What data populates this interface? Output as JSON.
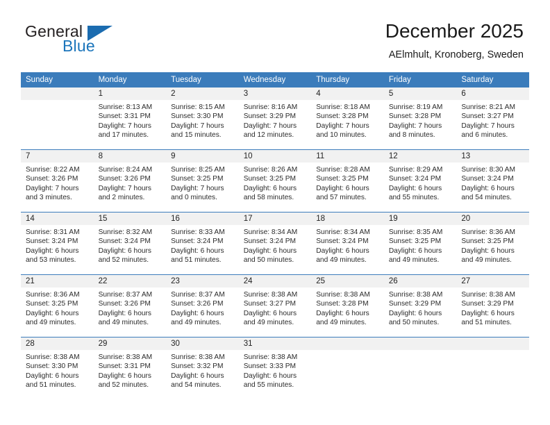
{
  "brand": {
    "name_part1": "General",
    "name_part2": "Blue",
    "logo_icon": "triangle-logo-icon"
  },
  "header": {
    "title": "December 2025",
    "subtitle": "AElmhult, Kronoberg, Sweden"
  },
  "calendar": {
    "weekday_headers": [
      "Sunday",
      "Monday",
      "Tuesday",
      "Wednesday",
      "Thursday",
      "Friday",
      "Saturday"
    ],
    "accent_color": "#3b7cbb",
    "daynum_band_color": "#f1f1f1",
    "weeks": [
      [
        {
          "day": "",
          "sunrise": "",
          "sunset": "",
          "daylight_line1": "",
          "daylight_line2": ""
        },
        {
          "day": "1",
          "sunrise": "Sunrise: 8:13 AM",
          "sunset": "Sunset: 3:31 PM",
          "daylight_line1": "Daylight: 7 hours",
          "daylight_line2": "and 17 minutes."
        },
        {
          "day": "2",
          "sunrise": "Sunrise: 8:15 AM",
          "sunset": "Sunset: 3:30 PM",
          "daylight_line1": "Daylight: 7 hours",
          "daylight_line2": "and 15 minutes."
        },
        {
          "day": "3",
          "sunrise": "Sunrise: 8:16 AM",
          "sunset": "Sunset: 3:29 PM",
          "daylight_line1": "Daylight: 7 hours",
          "daylight_line2": "and 12 minutes."
        },
        {
          "day": "4",
          "sunrise": "Sunrise: 8:18 AM",
          "sunset": "Sunset: 3:28 PM",
          "daylight_line1": "Daylight: 7 hours",
          "daylight_line2": "and 10 minutes."
        },
        {
          "day": "5",
          "sunrise": "Sunrise: 8:19 AM",
          "sunset": "Sunset: 3:28 PM",
          "daylight_line1": "Daylight: 7 hours",
          "daylight_line2": "and 8 minutes."
        },
        {
          "day": "6",
          "sunrise": "Sunrise: 8:21 AM",
          "sunset": "Sunset: 3:27 PM",
          "daylight_line1": "Daylight: 7 hours",
          "daylight_line2": "and 6 minutes."
        }
      ],
      [
        {
          "day": "7",
          "sunrise": "Sunrise: 8:22 AM",
          "sunset": "Sunset: 3:26 PM",
          "daylight_line1": "Daylight: 7 hours",
          "daylight_line2": "and 3 minutes."
        },
        {
          "day": "8",
          "sunrise": "Sunrise: 8:24 AM",
          "sunset": "Sunset: 3:26 PM",
          "daylight_line1": "Daylight: 7 hours",
          "daylight_line2": "and 2 minutes."
        },
        {
          "day": "9",
          "sunrise": "Sunrise: 8:25 AM",
          "sunset": "Sunset: 3:25 PM",
          "daylight_line1": "Daylight: 7 hours",
          "daylight_line2": "and 0 minutes."
        },
        {
          "day": "10",
          "sunrise": "Sunrise: 8:26 AM",
          "sunset": "Sunset: 3:25 PM",
          "daylight_line1": "Daylight: 6 hours",
          "daylight_line2": "and 58 minutes."
        },
        {
          "day": "11",
          "sunrise": "Sunrise: 8:28 AM",
          "sunset": "Sunset: 3:25 PM",
          "daylight_line1": "Daylight: 6 hours",
          "daylight_line2": "and 57 minutes."
        },
        {
          "day": "12",
          "sunrise": "Sunrise: 8:29 AM",
          "sunset": "Sunset: 3:24 PM",
          "daylight_line1": "Daylight: 6 hours",
          "daylight_line2": "and 55 minutes."
        },
        {
          "day": "13",
          "sunrise": "Sunrise: 8:30 AM",
          "sunset": "Sunset: 3:24 PM",
          "daylight_line1": "Daylight: 6 hours",
          "daylight_line2": "and 54 minutes."
        }
      ],
      [
        {
          "day": "14",
          "sunrise": "Sunrise: 8:31 AM",
          "sunset": "Sunset: 3:24 PM",
          "daylight_line1": "Daylight: 6 hours",
          "daylight_line2": "and 53 minutes."
        },
        {
          "day": "15",
          "sunrise": "Sunrise: 8:32 AM",
          "sunset": "Sunset: 3:24 PM",
          "daylight_line1": "Daylight: 6 hours",
          "daylight_line2": "and 52 minutes."
        },
        {
          "day": "16",
          "sunrise": "Sunrise: 8:33 AM",
          "sunset": "Sunset: 3:24 PM",
          "daylight_line1": "Daylight: 6 hours",
          "daylight_line2": "and 51 minutes."
        },
        {
          "day": "17",
          "sunrise": "Sunrise: 8:34 AM",
          "sunset": "Sunset: 3:24 PM",
          "daylight_line1": "Daylight: 6 hours",
          "daylight_line2": "and 50 minutes."
        },
        {
          "day": "18",
          "sunrise": "Sunrise: 8:34 AM",
          "sunset": "Sunset: 3:24 PM",
          "daylight_line1": "Daylight: 6 hours",
          "daylight_line2": "and 49 minutes."
        },
        {
          "day": "19",
          "sunrise": "Sunrise: 8:35 AM",
          "sunset": "Sunset: 3:25 PM",
          "daylight_line1": "Daylight: 6 hours",
          "daylight_line2": "and 49 minutes."
        },
        {
          "day": "20",
          "sunrise": "Sunrise: 8:36 AM",
          "sunset": "Sunset: 3:25 PM",
          "daylight_line1": "Daylight: 6 hours",
          "daylight_line2": "and 49 minutes."
        }
      ],
      [
        {
          "day": "21",
          "sunrise": "Sunrise: 8:36 AM",
          "sunset": "Sunset: 3:25 PM",
          "daylight_line1": "Daylight: 6 hours",
          "daylight_line2": "and 49 minutes."
        },
        {
          "day": "22",
          "sunrise": "Sunrise: 8:37 AM",
          "sunset": "Sunset: 3:26 PM",
          "daylight_line1": "Daylight: 6 hours",
          "daylight_line2": "and 49 minutes."
        },
        {
          "day": "23",
          "sunrise": "Sunrise: 8:37 AM",
          "sunset": "Sunset: 3:26 PM",
          "daylight_line1": "Daylight: 6 hours",
          "daylight_line2": "and 49 minutes."
        },
        {
          "day": "24",
          "sunrise": "Sunrise: 8:38 AM",
          "sunset": "Sunset: 3:27 PM",
          "daylight_line1": "Daylight: 6 hours",
          "daylight_line2": "and 49 minutes."
        },
        {
          "day": "25",
          "sunrise": "Sunrise: 8:38 AM",
          "sunset": "Sunset: 3:28 PM",
          "daylight_line1": "Daylight: 6 hours",
          "daylight_line2": "and 49 minutes."
        },
        {
          "day": "26",
          "sunrise": "Sunrise: 8:38 AM",
          "sunset": "Sunset: 3:29 PM",
          "daylight_line1": "Daylight: 6 hours",
          "daylight_line2": "and 50 minutes."
        },
        {
          "day": "27",
          "sunrise": "Sunrise: 8:38 AM",
          "sunset": "Sunset: 3:29 PM",
          "daylight_line1": "Daylight: 6 hours",
          "daylight_line2": "and 51 minutes."
        }
      ],
      [
        {
          "day": "28",
          "sunrise": "Sunrise: 8:38 AM",
          "sunset": "Sunset: 3:30 PM",
          "daylight_line1": "Daylight: 6 hours",
          "daylight_line2": "and 51 minutes."
        },
        {
          "day": "29",
          "sunrise": "Sunrise: 8:38 AM",
          "sunset": "Sunset: 3:31 PM",
          "daylight_line1": "Daylight: 6 hours",
          "daylight_line2": "and 52 minutes."
        },
        {
          "day": "30",
          "sunrise": "Sunrise: 8:38 AM",
          "sunset": "Sunset: 3:32 PM",
          "daylight_line1": "Daylight: 6 hours",
          "daylight_line2": "and 54 minutes."
        },
        {
          "day": "31",
          "sunrise": "Sunrise: 8:38 AM",
          "sunset": "Sunset: 3:33 PM",
          "daylight_line1": "Daylight: 6 hours",
          "daylight_line2": "and 55 minutes."
        },
        {
          "day": "",
          "sunrise": "",
          "sunset": "",
          "daylight_line1": "",
          "daylight_line2": ""
        },
        {
          "day": "",
          "sunrise": "",
          "sunset": "",
          "daylight_line1": "",
          "daylight_line2": ""
        },
        {
          "day": "",
          "sunrise": "",
          "sunset": "",
          "daylight_line1": "",
          "daylight_line2": ""
        }
      ]
    ]
  }
}
